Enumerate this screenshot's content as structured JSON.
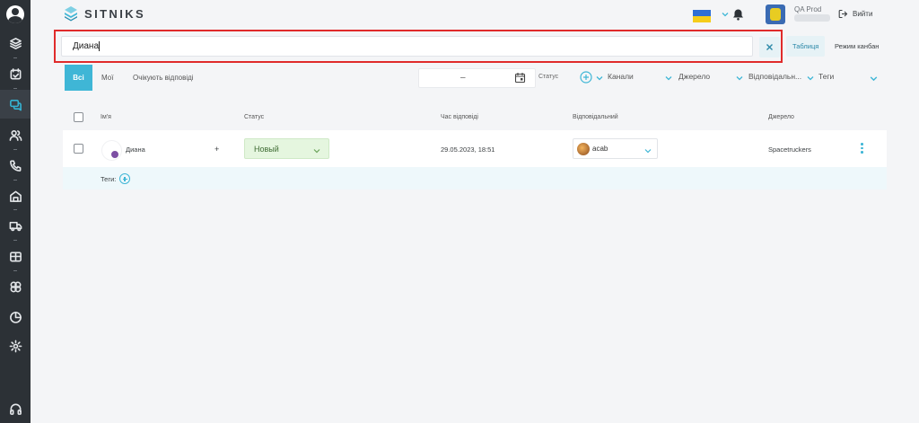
{
  "app": {
    "brand": "SITNIKS"
  },
  "header": {
    "user_name": "QA Prod",
    "logout_label": "Вийти",
    "language_flag": "ukraine-flag"
  },
  "search": {
    "value": "Диана"
  },
  "view_modes": {
    "table": "Таблиця",
    "kanban": "Режим канбан"
  },
  "filter_tabs": [
    "Всі",
    "Мої",
    "Очікують відповіді"
  ],
  "filters": {
    "date_separator": "–",
    "status": "Статус",
    "channels": "Канали",
    "source": "Джерело",
    "responsible": "Відповідальн...",
    "tags": "Теги"
  },
  "table": {
    "headers": {
      "name": "Ім'я",
      "status": "Статус",
      "reply_time": "Час відповіді",
      "responsible": "Відповідальний",
      "source": "Джерело"
    },
    "rows": [
      {
        "name": "Диана",
        "plus": "+",
        "status": "Новый",
        "reply_time": "29.05.2023, 18:51",
        "responsible": "acab",
        "source": "Spacetruckers",
        "tags_label": "Теги:"
      }
    ]
  },
  "colors": {
    "sidebar": "#2c3136",
    "accent": "#3fb6d6",
    "highlight": "#e02b2b",
    "status_bg": "#e5f6df"
  }
}
